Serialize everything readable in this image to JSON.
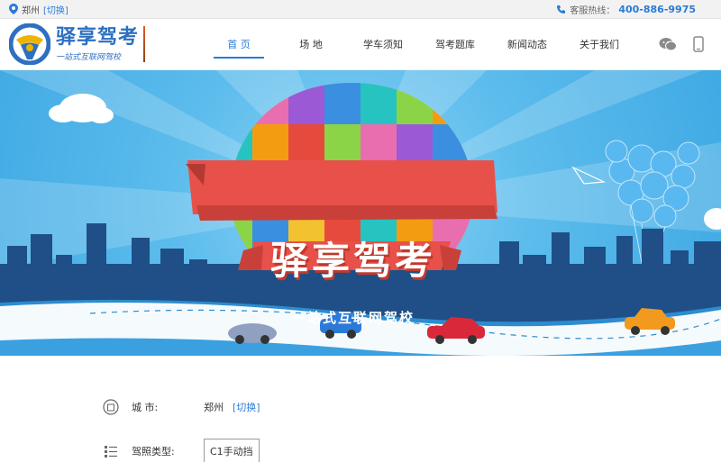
{
  "topbar": {
    "city": "郑州",
    "switch_label": "[切换]",
    "hotline_label": "客服热线：",
    "hotline_number": "400-886-9975"
  },
  "header": {
    "brand": "驿享驾考",
    "slogan": "一站式互联网驾校",
    "nav": [
      {
        "label": "首 页",
        "active": true
      },
      {
        "label": "场 地"
      },
      {
        "label": "学车须知"
      },
      {
        "label": "驾考题库"
      },
      {
        "label": "新闻动态"
      },
      {
        "label": "关于我们"
      }
    ],
    "icons": [
      "wechat-icon",
      "mobile-icon"
    ]
  },
  "banner": {
    "title": "驿享驾考",
    "subtitle": "一站式互联网驾校"
  },
  "info": {
    "city_label": "城      市:",
    "city_value": "郑州",
    "city_switch": "[切换]",
    "license_label": "驾照类型:",
    "license_value": "C1手动挡"
  },
  "colors": {
    "accent": "#2a7bd6",
    "sky": "#5cbcec",
    "ribbon": "#e8504a"
  }
}
